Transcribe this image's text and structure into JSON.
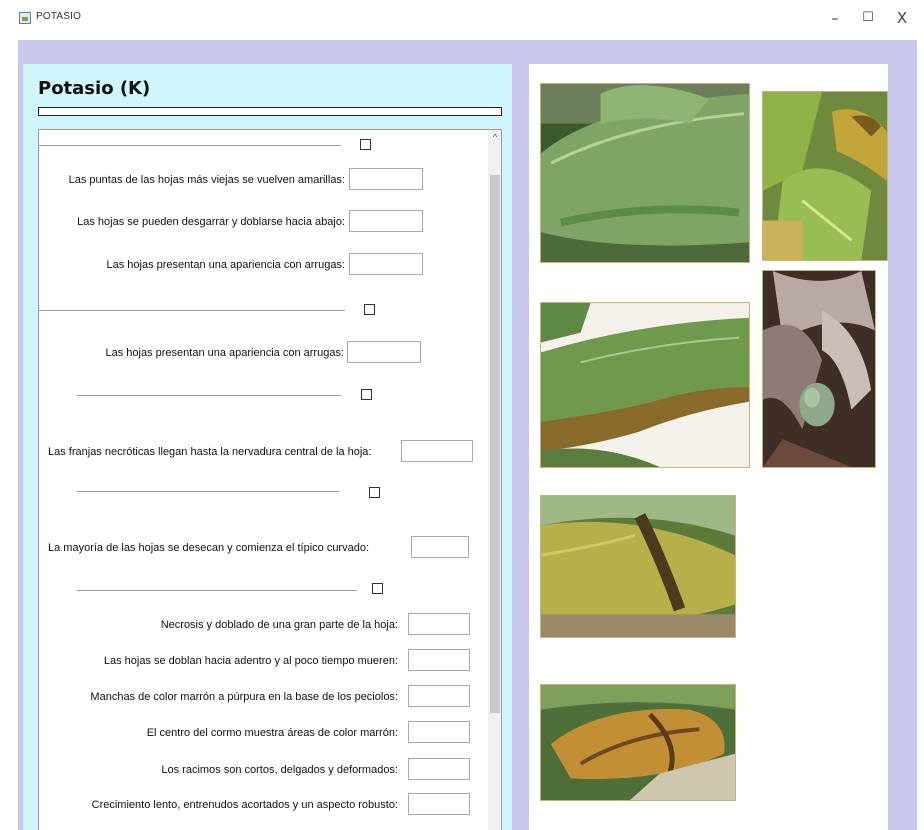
{
  "window": {
    "title": "POTASIO",
    "minimize": "–",
    "maximize": "☐",
    "close": "X"
  },
  "panel": {
    "heading": "Potasio (K)",
    "progress": 0
  },
  "questions": [
    "Las puntas de las hojas más viejas se vuelven amarillas:",
    "Las hojas se pueden desgarrar y doblarse hacia abajo:",
    "Las hojas presentan una apariencia con arrugas:",
    "Las hojas presentan una apariencia con arrugas:",
    "Las franjas necróticas llegan hasta la nervadura central de la hoja:",
    "La mayoría de las hojas se desecan y comienza el típico curvado:",
    "Necrosis y doblado de una gran parte de la hoja:",
    "Las hojas se doblan hacia adentro y al poco tiempo mueren:",
    "Manchas de color marrón a púrpura en la base de los peciolos:",
    "El centro del cormo muestra áreas de color marrón:",
    "Los racimos son cortos, delgados y deformados:",
    "Crecimiento lento, entrenudos acortados y un aspecto robusto:"
  ],
  "images": [
    {
      "name": "banana-leaf-green-photo"
    },
    {
      "name": "banana-plant-yellow-tip-photo"
    },
    {
      "name": "banana-leaf-necrotic-edge-photo"
    },
    {
      "name": "banana-plant-drooping-bunch-photo"
    },
    {
      "name": "banana-leaf-necrotic-band-photo"
    },
    {
      "name": "banana-leaf-dried-photo"
    }
  ],
  "colors": {
    "left_panel": "#cff7fb",
    "frame": "#c9c9ec",
    "progress_fill": "#3b7bd9"
  }
}
